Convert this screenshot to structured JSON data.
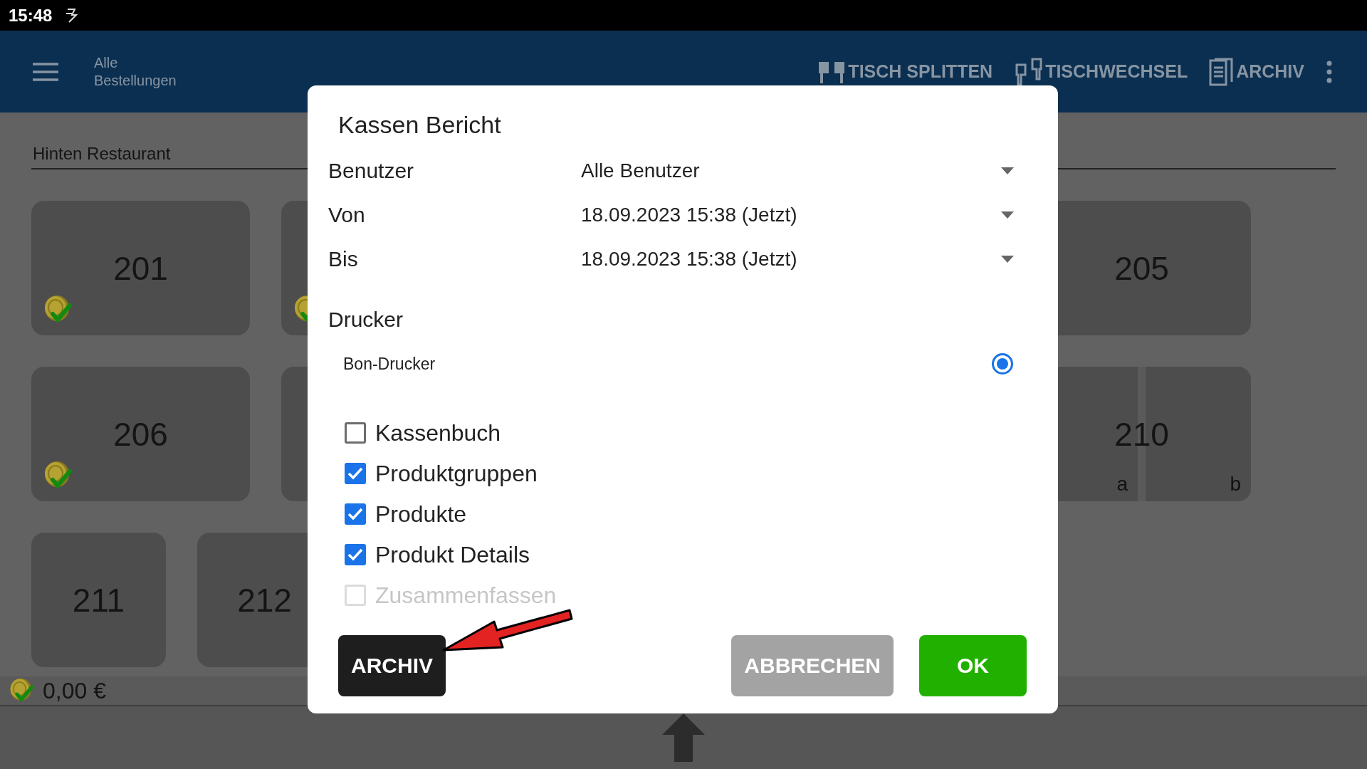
{
  "status_bar": {
    "time": "15:48"
  },
  "app_bar": {
    "title": "Alle Bestellungen",
    "actions": [
      {
        "label": "TISCH SPLITTEN",
        "kind": "split"
      },
      {
        "label": "TISCHWECHSEL",
        "kind": "switch"
      },
      {
        "label": "ARCHIV",
        "kind": "archive"
      }
    ]
  },
  "area": {
    "name": "Hinten Restaurant"
  },
  "table_rows": [
    {
      "kind": "large",
      "tables": [
        {
          "number": "201",
          "paid": true
        },
        {
          "paid": true
        },
        {
          "number": "205",
          "paid": false
        }
      ]
    },
    {
      "kind": "large",
      "tables": [
        {
          "number": "206",
          "paid": true
        },
        {
          "paid": false
        },
        {
          "number": "210",
          "paid": false,
          "parts": [
            "a",
            "b"
          ]
        }
      ]
    },
    {
      "kind": "small",
      "tables": [
        {
          "number": "211",
          "paid": false
        },
        {
          "number": "212",
          "paid": false
        }
      ]
    }
  ],
  "footer": {
    "total": "0,00 €"
  },
  "dialog": {
    "title": "Kassen Bericht",
    "fields": [
      {
        "label": "Benutzer",
        "value": "Alle Benutzer"
      },
      {
        "label": "Von",
        "value": "18.09.2023 15:38 (Jetzt)"
      },
      {
        "label": "Bis",
        "value": "18.09.2023 15:38 (Jetzt)"
      }
    ],
    "printer_heading": "Drucker",
    "printers": [
      {
        "name": "Bon-Drucker",
        "selected": true
      }
    ],
    "options": [
      {
        "label": "Kassenbuch",
        "checked": false,
        "disabled": false
      },
      {
        "label": "Produktgruppen",
        "checked": true,
        "disabled": false
      },
      {
        "label": "Produkte",
        "checked": true,
        "disabled": false
      },
      {
        "label": "Produkt Details",
        "checked": true,
        "disabled": false
      },
      {
        "label": "Zusammenfassen",
        "checked": false,
        "disabled": true
      }
    ],
    "buttons": [
      {
        "label": "ARCHIV",
        "kind": "dark"
      },
      {
        "label": "ABBRECHEN",
        "kind": "neutral"
      },
      {
        "label": "OK",
        "kind": "primary"
      }
    ]
  }
}
